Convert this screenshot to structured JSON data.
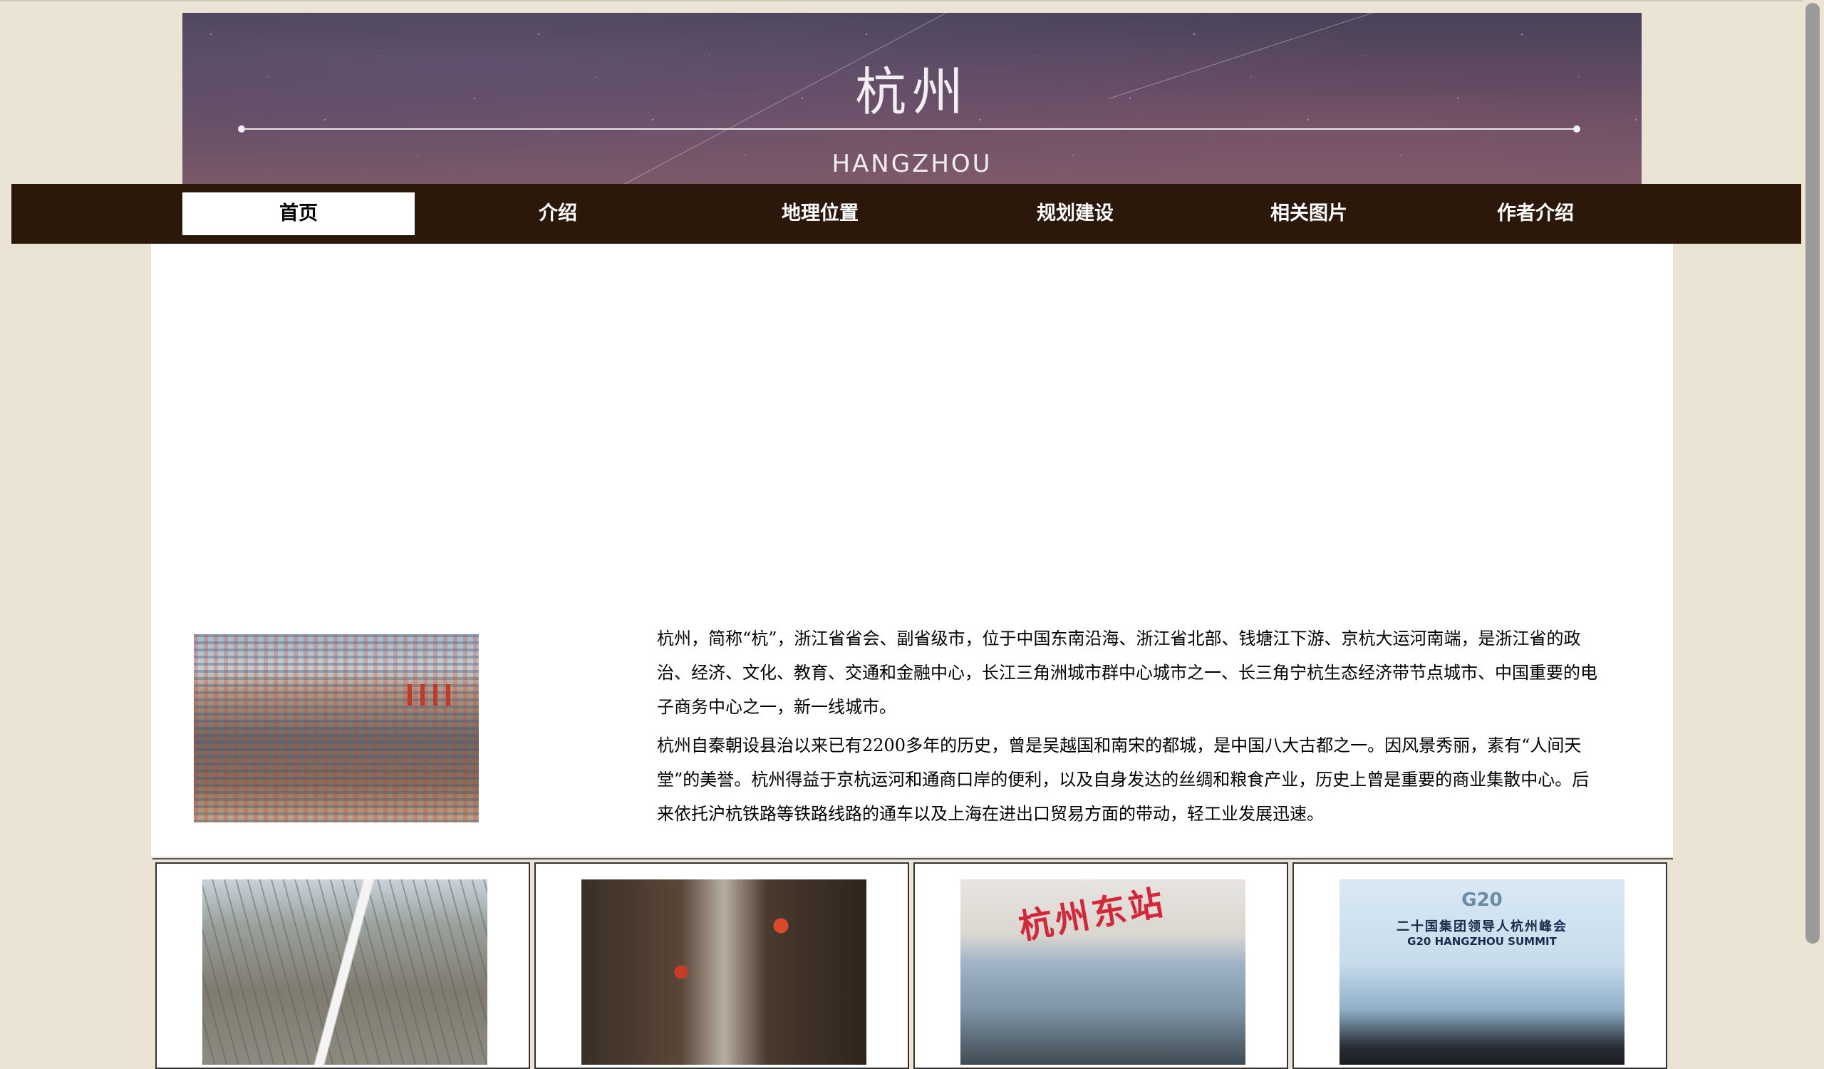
{
  "banner": {
    "title": "杭州",
    "subtitle": "HANGZHOU"
  },
  "nav": {
    "items": [
      {
        "label": "首页",
        "active": true
      },
      {
        "label": "介绍",
        "active": false
      },
      {
        "label": "地理位置",
        "active": false
      },
      {
        "label": "规划建设",
        "active": false
      },
      {
        "label": "相关图片",
        "active": false
      },
      {
        "label": "作者介绍",
        "active": false
      }
    ]
  },
  "intro": {
    "paragraph1": "杭州，简称“杭”，浙江省省会、副省级市，位于中国东南沿海、浙江省北部、钱塘江下游、京杭大运河南端，是浙江省的政治、经济、文化、教育、交通和金融中心，长江三角洲城市群中心城市之一、长三角宁杭生态经济带节点城市、中国重要的电子商务中心之一，新一线城市。",
    "paragraph2": "杭州自秦朝设县治以来已有2200多年的历史，曾是吴越国和南宋的都城，是中国八大古都之一。因风景秀丽，素有“人间天堂”的美誉。杭州得益于京杭运河和通商口岸的便利，以及自身发达的丝绸和粮食产业，历史上曾是重要的商业集散中心。后来依托沪杭铁路等铁路线路的通车以及上海在进出口贸易方面的带动，轻工业发展迅速。"
  },
  "gallery": {
    "station_sign": "杭州东站",
    "g20_logo": "G20",
    "g20_cn": "二十国集团领导人杭州峰会",
    "g20_en": "G20 HANGZHOU SUMMIT"
  }
}
